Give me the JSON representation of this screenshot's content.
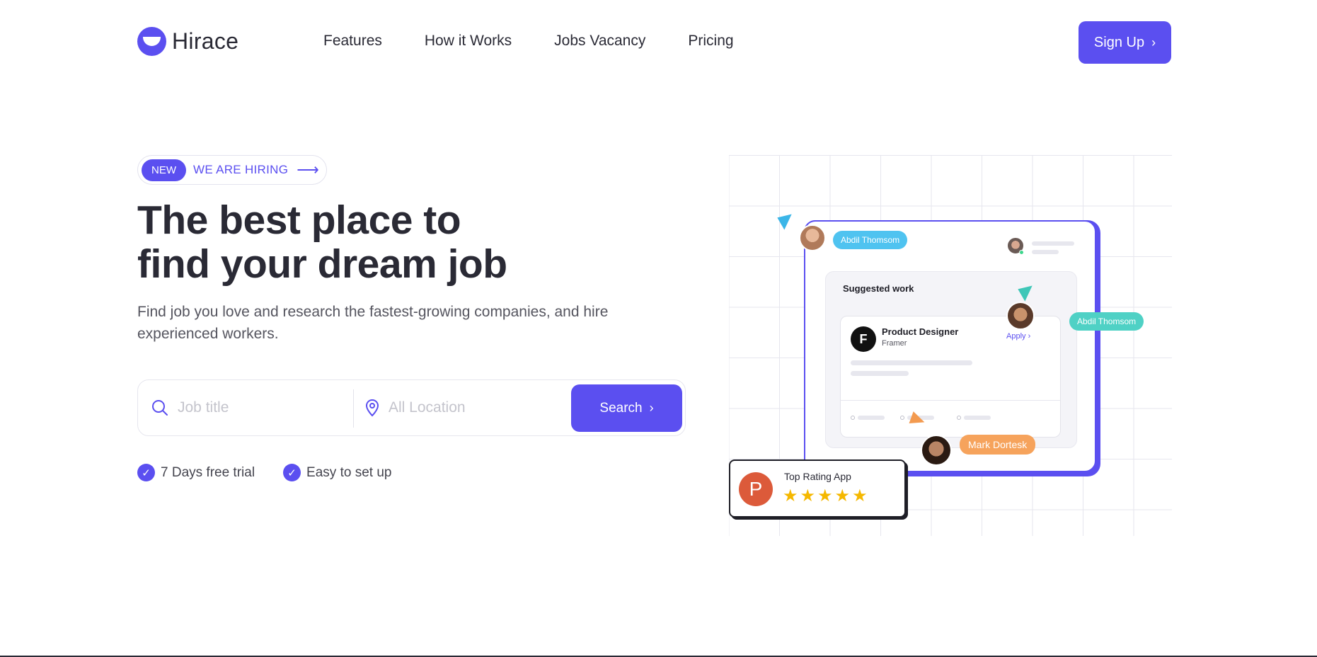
{
  "brand": {
    "name": "Hirace",
    "logo_icon": "smile-logo-icon",
    "accent": "#5b4ff0"
  },
  "nav": {
    "links": [
      "Features",
      "How it Works",
      "Jobs Vacancy",
      "Pricing"
    ],
    "signup_label": "Sign Up"
  },
  "hero": {
    "badge": "NEW",
    "badge_text": "WE ARE HIRING",
    "headline_line1": "The best place to",
    "headline_line2": "find your dream job",
    "subtext": "Find job you love and research the fastest-growing companies, and hire experienced workers."
  },
  "search": {
    "job_placeholder": "Job title",
    "location_placeholder": "All Location",
    "button_label": "Search"
  },
  "perks": [
    "7 Days free trial",
    "Easy to set up"
  ],
  "illustration": {
    "tag_top": "Abdil Thomsom",
    "tag_right": "Abdil Thomsom",
    "tag_bottom": "Mark Dortesk",
    "card_title": "Suggested work",
    "job_title": "Product Designer",
    "job_company": "Framer",
    "apply_label": "Apply",
    "rating_title": "Top Rating App",
    "rating_logo_letter": "P",
    "rating_stars": 5
  }
}
